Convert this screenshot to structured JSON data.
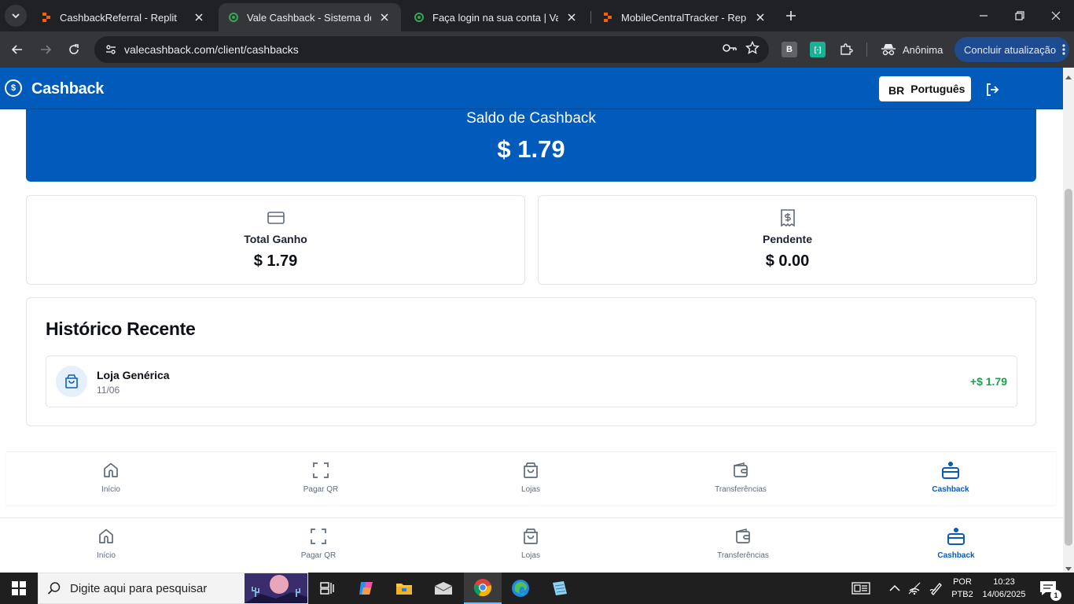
{
  "browser": {
    "tabs": [
      {
        "title": "CashbackReferral - Replit",
        "favicon": "replit-icon",
        "active": false
      },
      {
        "title": "Vale Cashback - Sistema de Cas",
        "favicon": "vale-icon",
        "active": true
      },
      {
        "title": "Faça login na sua conta | Vale C",
        "favicon": "vale-icon",
        "active": false
      },
      {
        "title": "MobileCentralTracker - Replit",
        "favicon": "replit-icon",
        "active": false
      }
    ],
    "url": "valecashback.com/client/cashbacks",
    "incognito_label": "Anônima",
    "update_label": "Concluir atualização",
    "extensions": [
      "B",
      "[-]"
    ]
  },
  "header": {
    "logo_text": "$",
    "title": "Cashback",
    "language": {
      "flag": "BR",
      "label": "Português"
    }
  },
  "balance": {
    "label": "Saldo de Cashback",
    "value": "$ 1.79"
  },
  "stats": [
    {
      "label": "Total Ganho",
      "value": "$ 1.79",
      "icon": "credit-card-icon"
    },
    {
      "label": "Pendente",
      "value": "$ 0.00",
      "icon": "receipt-icon"
    }
  ],
  "history": {
    "title": "Histórico Recente",
    "items": [
      {
        "store": "Loja Genérica",
        "date": "11/06",
        "amount": "+$ 1.79",
        "icon": "shopping-bag-icon"
      }
    ]
  },
  "nav": {
    "items": [
      {
        "label": "Início",
        "icon": "home-icon"
      },
      {
        "label": "Pagar QR",
        "icon": "scan-icon"
      },
      {
        "label": "Lojas",
        "icon": "shopping-bag-icon"
      },
      {
        "label": "Transferências",
        "icon": "wallet-icon"
      },
      {
        "label": "Cashback",
        "icon": "cashback-icon"
      }
    ],
    "active_index": 4
  },
  "taskbar": {
    "search_placeholder": "Digite aqui para pesquisar",
    "lang_line1": "POR",
    "lang_line2": "PTB2",
    "time": "10:23",
    "date": "14/06/2025",
    "notification_count": "1"
  },
  "colors": {
    "brand_blue": "#005bbb",
    "positive_green": "#16a34a",
    "browser_dark": "#202124"
  }
}
